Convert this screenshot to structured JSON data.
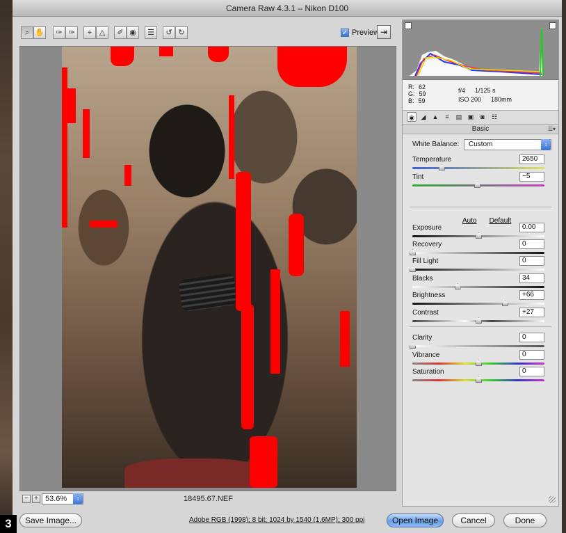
{
  "window": {
    "title": "Camera Raw 4.3.1 – Nikon D100"
  },
  "toolbar": {
    "tools": [
      {
        "name": "zoom-icon",
        "glyph": "⌕"
      },
      {
        "name": "hand-icon",
        "glyph": "✋"
      },
      {
        "name": "white-balance-eyedropper-icon",
        "glyph": "✑"
      },
      {
        "name": "color-sampler-icon",
        "glyph": "✑"
      },
      {
        "name": "crop-icon",
        "glyph": "⌖"
      },
      {
        "name": "straighten-icon",
        "glyph": "△"
      },
      {
        "name": "retouch-icon",
        "glyph": "✐"
      },
      {
        "name": "red-eye-icon",
        "glyph": "◉"
      },
      {
        "name": "preferences-icon",
        "glyph": "☰"
      },
      {
        "name": "rotate-ccw-icon",
        "glyph": "↺"
      },
      {
        "name": "rotate-cw-icon",
        "glyph": "↻"
      }
    ],
    "preview_label": "Preview",
    "preview_checked": "✓",
    "fullscreen_glyph": "⇥"
  },
  "status": {
    "zoom_minus": "−",
    "zoom_plus": "+",
    "zoom_value": "53.6%",
    "zoom_arrow": "↕",
    "filename": "18495.67.NEF"
  },
  "bottom": {
    "save_label": "Save Image...",
    "workflow_link": "Adobe RGB (1998); 8 bit; 1024 by 1540 (1.6MP); 300 ppi",
    "open_label": "Open Image",
    "cancel_label": "Cancel",
    "done_label": "Done",
    "badge": "3"
  },
  "readout": {
    "r_label": "R:",
    "r_value": "62",
    "g_label": "G:",
    "g_value": "59",
    "b_label": "B:",
    "b_value": "59",
    "aperture": "f/4",
    "shutter": "1/125 s",
    "iso": "ISO 200",
    "focal": "180mm"
  },
  "panel": {
    "tabs": [
      {
        "name": "basic-tab-icon",
        "glyph": "◉"
      },
      {
        "name": "tone-curve-tab-icon",
        "glyph": "◢"
      },
      {
        "name": "detail-tab-icon",
        "glyph": "▲"
      },
      {
        "name": "hsl-tab-icon",
        "glyph": "≡"
      },
      {
        "name": "split-toning-tab-icon",
        "glyph": "▤"
      },
      {
        "name": "lens-corrections-tab-icon",
        "glyph": "▣"
      },
      {
        "name": "camera-calibration-tab-icon",
        "glyph": "◙"
      },
      {
        "name": "presets-tab-icon",
        "glyph": "☷"
      }
    ],
    "section_title": "Basic",
    "section_menu": "☰▾",
    "white_balance_label": "White Balance:",
    "white_balance_value": "Custom",
    "select_arrow": "↕",
    "auto_label": "Auto",
    "default_label": "Default",
    "sliders": [
      {
        "key": "temperature",
        "label": "Temperature",
        "value": "2650",
        "pos": 0.22,
        "track": "linear-gradient(90deg,#3a5fd6,#e0e060)"
      },
      {
        "key": "tint",
        "label": "Tint",
        "value": "−5",
        "pos": 0.49,
        "track": "linear-gradient(90deg,#2fb03a,#c23fc7)"
      },
      {
        "key": "exposure",
        "label": "Exposure",
        "value": "0.00",
        "pos": 0.5,
        "track": "linear-gradient(90deg,#111,#fff)"
      },
      {
        "key": "recovery",
        "label": "Recovery",
        "value": "0",
        "pos": 0.0,
        "track": "linear-gradient(90deg,#fff,#111)"
      },
      {
        "key": "fill_light",
        "label": "Fill Light",
        "value": "0",
        "pos": 0.0,
        "track": "linear-gradient(90deg,#111,#fff)"
      },
      {
        "key": "blacks",
        "label": "Blacks",
        "value": "34",
        "pos": 0.34,
        "track": "linear-gradient(90deg,#fff,#111)"
      },
      {
        "key": "brightness",
        "label": "Brightness",
        "value": "+66",
        "pos": 0.7,
        "track": "linear-gradient(90deg,#111,#fff)"
      },
      {
        "key": "contrast",
        "label": "Contrast",
        "value": "+27",
        "pos": 0.5,
        "track": "linear-gradient(90deg,#444,#fff 40%,#444 60%,#fff)"
      },
      {
        "key": "clarity",
        "label": "Clarity",
        "value": "0",
        "pos": 0.0,
        "track": "linear-gradient(90deg,#fff,#555)"
      },
      {
        "key": "vibrance",
        "label": "Vibrance",
        "value": "0",
        "pos": 0.5,
        "track": "linear-gradient(90deg,#888,#d33,#dd3,#3c3,#33c,#c3c)"
      },
      {
        "key": "saturation",
        "label": "Saturation",
        "value": "0",
        "pos": 0.5,
        "track": "linear-gradient(90deg,#888,#d33,#dd3,#3c3,#33c,#c3c)"
      }
    ]
  }
}
